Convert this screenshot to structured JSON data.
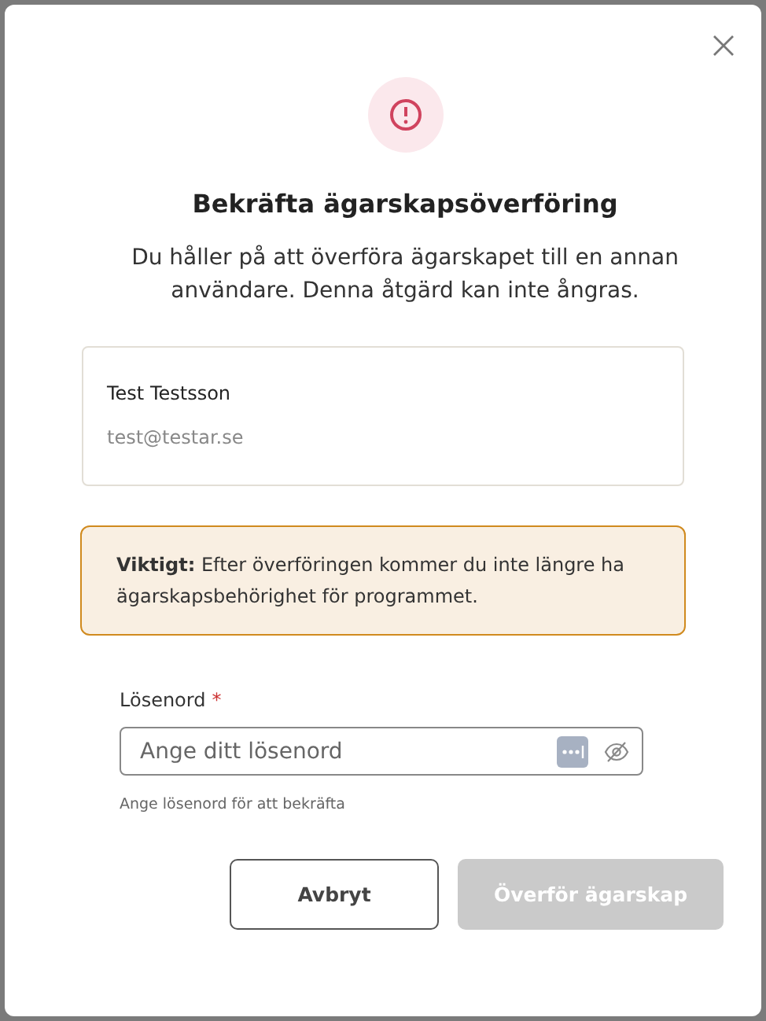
{
  "dialog": {
    "title": "Bekräfta ägarskapsöverföring",
    "description": "Du håller på att överföra ägarskapet till en annan användare. Denna åtgärd kan inte ångras."
  },
  "user": {
    "name": "Test Testsson",
    "email": "test@testar.se"
  },
  "warning": {
    "text": "**Viktigt:** Efter överföringen kommer du inte längre ha ägarskapsbehörighet för programmet."
  },
  "password": {
    "label": "Lösenord",
    "required": true,
    "required_mark": "*",
    "placeholder": "Ange ditt lösenord",
    "helper": "Ange lösenord för att bekräfta"
  },
  "buttons": [
    {
      "label": "Avbryt",
      "kind": "secondary",
      "disabled": false
    },
    {
      "label": "Överför ägarskap",
      "kind": "primary",
      "disabled": true
    }
  ]
}
